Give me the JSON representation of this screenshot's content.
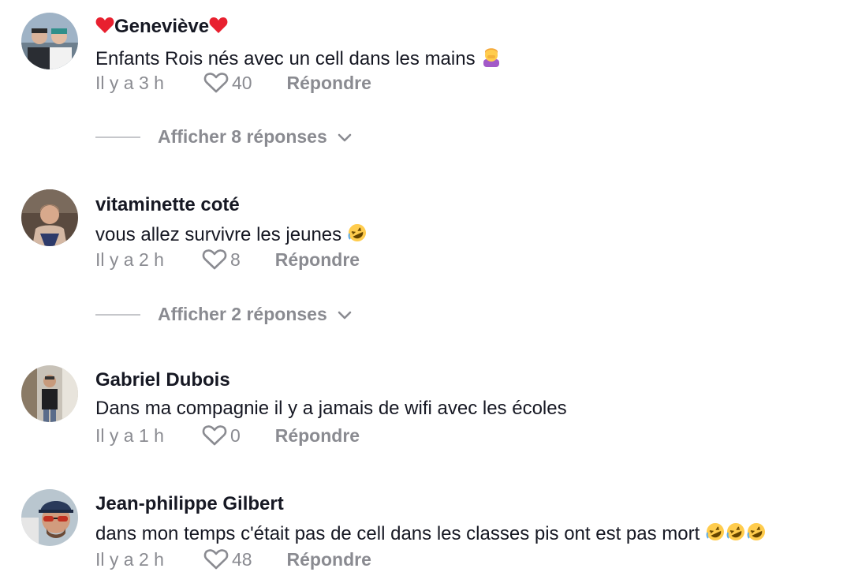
{
  "comments": [
    {
      "username": "Geneviève",
      "text": "Enfants Rois nés avec un cell dans les mains",
      "time": "Il y a 3 h",
      "likes": "40",
      "reply_label": "Répondre",
      "replies_label": "Afficher 8 réponses"
    },
    {
      "username": "vitaminette coté",
      "text": "vous allez survivre les jeunes",
      "time": "Il y a 2 h",
      "likes": "8",
      "reply_label": "Répondre",
      "replies_label": "Afficher 2 réponses"
    },
    {
      "username": "Gabriel Dubois",
      "text": "Dans ma compagnie il y a jamais de wifi avec les écoles",
      "time": "Il y a 1 h",
      "likes": "0",
      "reply_label": "Répondre"
    },
    {
      "username": "Jean-philippe Gilbert",
      "text": "dans mon temps c'était pas de cell dans les classes pis ont est pas mort",
      "time": "Il y a 2 h",
      "likes": "48",
      "reply_label": "Répondre"
    }
  ],
  "icons": {
    "like": "heart-outline-icon",
    "expand": "chevron-down-icon",
    "name_decoration": "red-heart-emoji",
    "facepalm": "woman-facepalming-emoji",
    "laugh": "rolling-on-floor-laughing-emoji"
  },
  "colors": {
    "primary_text": "#161823",
    "secondary_text": "#8a8b91",
    "divider": "#c6c7cb",
    "heart_emoji": "#e8202f"
  }
}
